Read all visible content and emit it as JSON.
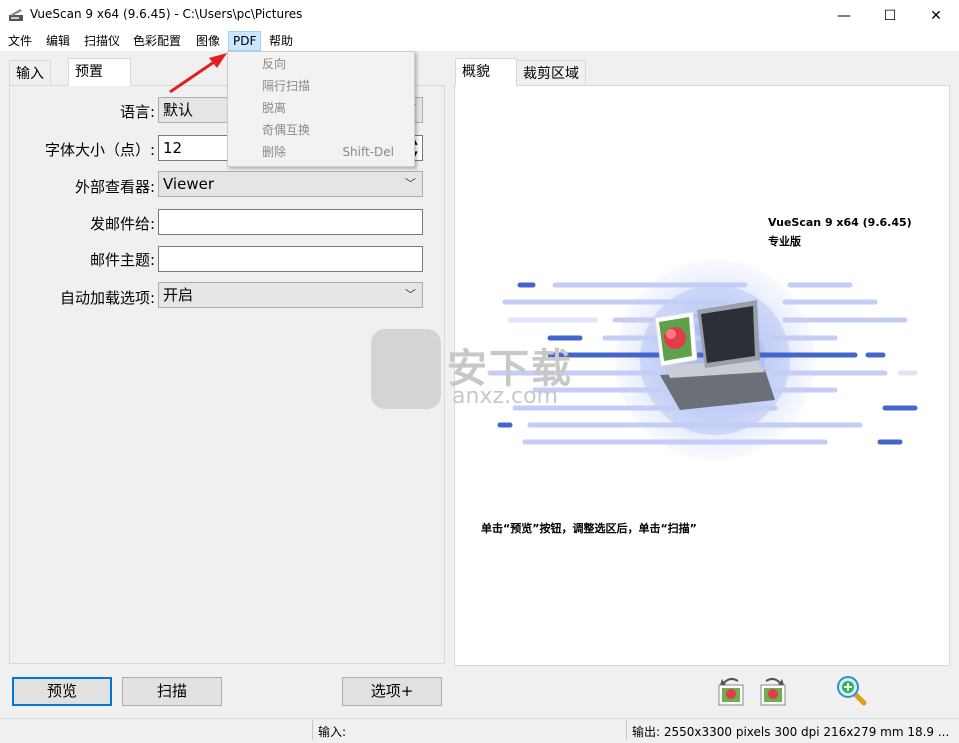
{
  "window": {
    "title": "VueScan 9 x64 (9.6.45) - C:\\Users\\pc\\Pictures",
    "minimize_glyph": "—",
    "maximize_glyph": "☐",
    "close_glyph": "✕"
  },
  "menu": {
    "items": [
      "文件",
      "编辑",
      "扫描仪",
      "色彩配置",
      "图像",
      "PDF",
      "帮助"
    ],
    "active": "PDF"
  },
  "pdf_menu": {
    "items": [
      {
        "label": "反向",
        "shortcut": ""
      },
      {
        "label": "隔行扫描",
        "shortcut": ""
      },
      {
        "label": "脱离",
        "shortcut": ""
      },
      {
        "label": "奇偶互换",
        "shortcut": ""
      },
      {
        "label": "删除",
        "shortcut": "Shift-Del"
      }
    ]
  },
  "left_tabs": [
    "输入",
    "预置"
  ],
  "left_tab_selected": "预置",
  "right_tabs": [
    "概貌",
    "裁剪区域"
  ],
  "right_tab_selected": "概貌",
  "form": {
    "language_label": "语言:",
    "language_value": "默认",
    "font_size_label": "字体大小（点）:",
    "font_size_value": "12",
    "viewer_label": "外部查看器:",
    "viewer_value": "Viewer",
    "email_to_label": "发邮件给:",
    "email_to_value": "",
    "email_subject_label": "邮件主题:",
    "email_subject_value": "",
    "autoload_label": "自动加载选项:",
    "autoload_value": "开启"
  },
  "preview": {
    "product_name": "VueScan 9 x64 (9.6.45)",
    "edition": "专业版",
    "instruction": "单击“预览”按钮，调整选区后，单击“扫描”",
    "watermark_text": "安下载",
    "watermark_sub": "anxz.com"
  },
  "buttons": {
    "preview": "预览",
    "scan": "扫描",
    "options": "选项+"
  },
  "status": {
    "input": "输入:",
    "output": "输出: 2550x3300 pixels 300 dpi 216x279 mm 18.9 ..."
  },
  "colors": {
    "accent": "#0078d7",
    "menu_highlight": "#cce8ff",
    "arrow_red": "#e02020",
    "scan_blue": "#3f5fd0"
  }
}
